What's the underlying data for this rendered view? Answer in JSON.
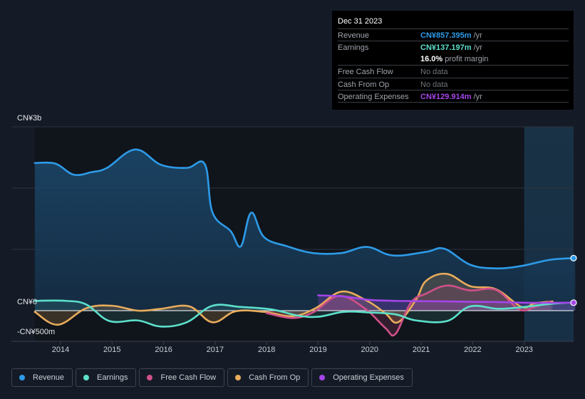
{
  "tooltip": {
    "date": "Dec 31 2023",
    "rows": [
      {
        "label": "Revenue",
        "value": "CN¥857.395m",
        "unit": " /yr",
        "color": "#2d9be8"
      },
      {
        "label": "Earnings",
        "value": "CN¥137.197m",
        "unit": " /yr",
        "color": "#5ce0cb"
      },
      {
        "label": "",
        "value": "16.0%",
        "unit": " profit margin",
        "color": "#ffffff"
      },
      {
        "label": "Free Cash Flow",
        "value": "No data",
        "unit": "",
        "color": "#6e737b"
      },
      {
        "label": "Cash From Op",
        "value": "No data",
        "unit": "",
        "color": "#6e737b"
      },
      {
        "label": "Operating Expenses",
        "value": "CN¥129.914m",
        "unit": " /yr",
        "color": "#a545e8"
      }
    ]
  },
  "legend": [
    {
      "label": "Revenue",
      "color": "#2d9be8"
    },
    {
      "label": "Earnings",
      "color": "#5ce0cb"
    },
    {
      "label": "Free Cash Flow",
      "color": "#d0508a"
    },
    {
      "label": "Cash From Op",
      "color": "#e9ac5b"
    },
    {
      "label": "Operating Expenses",
      "color": "#a545e8"
    }
  ],
  "chart_data": {
    "type": "line",
    "title": "",
    "xlabel": "",
    "ylabel": "",
    "y_unit": "CN¥ millions",
    "ylim": [
      -500,
      3000
    ],
    "xlim": [
      2013.5,
      2024.0
    ],
    "y_tick_labels": [
      "CN¥3b",
      "CN¥0",
      "-CN¥500m"
    ],
    "x_tick_labels": [
      "2014",
      "2015",
      "2016",
      "2017",
      "2018",
      "2019",
      "2020",
      "2021",
      "2022",
      "2023"
    ],
    "x_ticks": [
      2014,
      2015,
      2016,
      2017,
      2018,
      2019,
      2020,
      2021,
      2022,
      2023
    ],
    "forecast_shade_start": 2023.0,
    "legend_position": "bottom",
    "grid": true,
    "series": [
      {
        "name": "Revenue",
        "color": "#2d9be8",
        "x": [
          2013.5,
          2013.9,
          2014.25,
          2014.6,
          2014.9,
          2015.45,
          2015.95,
          2016.45,
          2016.8,
          2016.95,
          2017.3,
          2017.5,
          2017.7,
          2017.95,
          2018.4,
          2018.9,
          2019.45,
          2019.95,
          2020.45,
          2021.1,
          2021.45,
          2021.95,
          2022.45,
          2022.95,
          2023.5,
          2023.99
        ],
        "y": [
          2410,
          2400,
          2220,
          2260,
          2330,
          2630,
          2380,
          2330,
          2390,
          1600,
          1300,
          1050,
          1600,
          1200,
          1050,
          940,
          940,
          1040,
          900,
          960,
          1010,
          750,
          690,
          730,
          830,
          857
        ]
      },
      {
        "name": "Earnings",
        "color": "#5ce0cb",
        "x": [
          2013.5,
          2014.1,
          2014.5,
          2014.95,
          2015.5,
          2015.95,
          2016.45,
          2016.95,
          2017.5,
          2018.1,
          2018.6,
          2019.0,
          2019.5,
          2020.0,
          2020.5,
          2020.9,
          2021.5,
          2021.95,
          2022.5,
          2023.0,
          2023.5,
          2023.99
        ],
        "y": [
          160,
          160,
          100,
          -170,
          -160,
          -260,
          -190,
          80,
          60,
          20,
          -80,
          -100,
          -20,
          -30,
          -60,
          -160,
          -170,
          70,
          30,
          60,
          110,
          137
        ]
      },
      {
        "name": "Free Cash Flow",
        "color": "#d0508a",
        "x": [
          2018.0,
          2018.5,
          2018.9,
          2019.4,
          2019.9,
          2020.3,
          2020.5,
          2020.8,
          2021.1,
          2021.5,
          2021.95,
          2022.45,
          2022.9,
          2023.2,
          2023.5
        ],
        "y": [
          -40,
          -120,
          -30,
          240,
          40,
          -280,
          -380,
          130,
          280,
          410,
          330,
          340,
          20,
          60,
          150
        ]
      },
      {
        "name": "Cash From Op",
        "color": "#e9ac5b",
        "x": [
          2013.5,
          2013.95,
          2014.5,
          2015.0,
          2015.5,
          2015.95,
          2016.5,
          2016.95,
          2017.4,
          2017.95,
          2018.5,
          2018.95,
          2019.45,
          2019.95,
          2020.3,
          2020.55,
          2020.9,
          2021.1,
          2021.5,
          2021.95,
          2022.45,
          2022.95,
          2023.2,
          2023.55
        ],
        "y": [
          -20,
          -230,
          40,
          80,
          0,
          30,
          70,
          -190,
          -10,
          -20,
          -90,
          40,
          310,
          160,
          -40,
          -190,
          180,
          490,
          600,
          400,
          350,
          60,
          120,
          150
        ]
      },
      {
        "name": "Operating Expenses",
        "color": "#a545e8",
        "x": [
          2019.0,
          2019.5,
          2020.0,
          2020.5,
          2021.0,
          2021.5,
          2022.0,
          2022.5,
          2023.0,
          2023.5,
          2023.99
        ],
        "y": [
          250,
          230,
          175,
          160,
          155,
          150,
          145,
          140,
          130,
          128,
          130
        ]
      }
    ]
  }
}
